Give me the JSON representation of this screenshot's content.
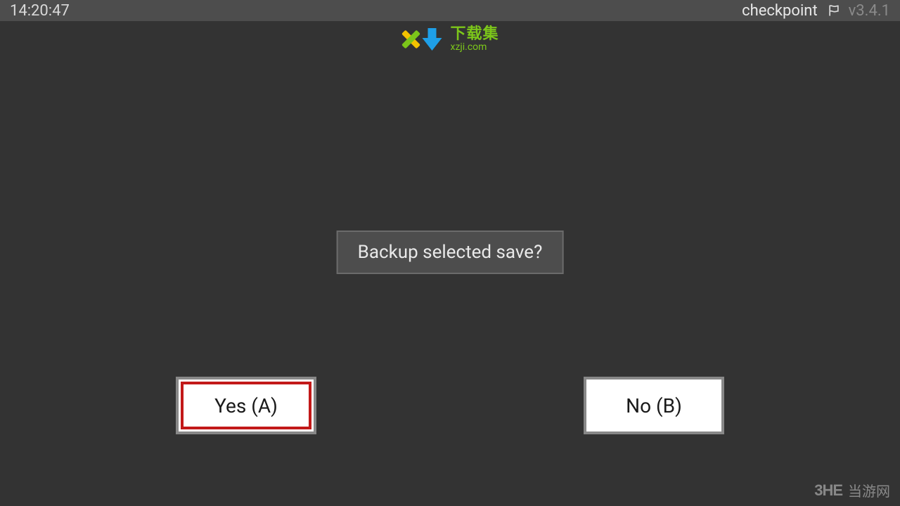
{
  "topbar": {
    "time": "14:20:47",
    "app_name": "checkpoint",
    "version": "v3.4.1"
  },
  "watermark_top": {
    "cn": "下载集",
    "en": "xzji.com"
  },
  "dialog": {
    "message": "Backup selected save?",
    "yes_label": "Yes (A)",
    "no_label": "No (B)"
  },
  "watermark_bottom": {
    "logo": "3HE",
    "cn": "当游网"
  }
}
